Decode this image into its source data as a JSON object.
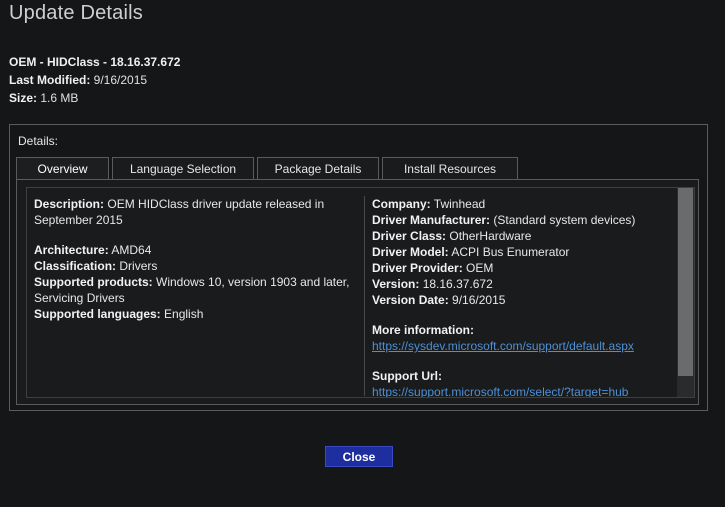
{
  "window": {
    "title": "Update Details"
  },
  "summary": {
    "name": "OEM - HIDClass - 18.16.37.672",
    "last_modified_label": "Last Modified:",
    "last_modified_value": "9/16/2015",
    "size_label": "Size:",
    "size_value": "1.6 MB"
  },
  "details": {
    "label": "Details:",
    "tabs": [
      {
        "label": "Overview",
        "active": true
      },
      {
        "label": "Language Selection",
        "active": false
      },
      {
        "label": "Package Details",
        "active": false
      },
      {
        "label": "Install Resources",
        "active": false
      }
    ],
    "overview": {
      "description_label": "Description:",
      "description_value": "OEM HIDClass driver update released in September 2015",
      "architecture_label": "Architecture:",
      "architecture_value": "AMD64",
      "classification_label": "Classification:",
      "classification_value": "Drivers",
      "supported_products_label": "Supported products:",
      "supported_products_value": "Windows 10, version 1903 and later, Servicing Drivers",
      "supported_languages_label": "Supported languages:",
      "supported_languages_value": "English",
      "company_label": "Company:",
      "company_value": "Twinhead",
      "driver_manufacturer_label": "Driver Manufacturer:",
      "driver_manufacturer_value": "(Standard system devices)",
      "driver_class_label": "Driver Class:",
      "driver_class_value": "OtherHardware",
      "driver_model_label": "Driver Model:",
      "driver_model_value": "ACPI Bus Enumerator",
      "driver_provider_label": "Driver Provider:",
      "driver_provider_value": "OEM",
      "version_label": "Version:",
      "version_value": "18.16.37.672",
      "version_date_label": "Version Date:",
      "version_date_value": "9/16/2015",
      "more_info_label": "More information:",
      "more_info_link": "https://sysdev.microsoft.com/support/default.aspx",
      "support_url_label": "Support Url:",
      "support_url_link": "https://support.microsoft.com/select/?target=hub"
    }
  },
  "footer": {
    "close_label": "Close"
  },
  "colors": {
    "background": "#151617",
    "border": "#5b5b5b",
    "link": "#4e8fd6",
    "primary_button": "#1f2e9e"
  }
}
